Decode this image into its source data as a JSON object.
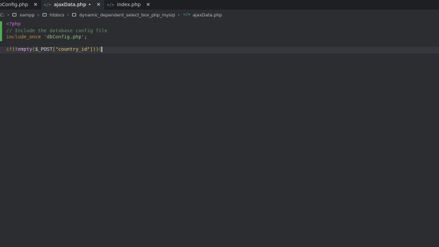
{
  "tabs": [
    {
      "label": "dbConfig.php",
      "icon": "",
      "active": false,
      "dirty": false,
      "close": "✕"
    },
    {
      "label": "ajaxData.php",
      "icon": "</>",
      "active": true,
      "dirty": true,
      "close": "✕",
      "dirty_mark": "•"
    },
    {
      "label": "index.php",
      "icon": "</>",
      "active": false,
      "dirty": false,
      "close": "✕"
    }
  ],
  "breadcrumb": {
    "root": "C:",
    "items": [
      "xampp",
      "htdocs",
      "dynamic_dependent_select_box_php_mysql",
      "ajaxData.php"
    ],
    "file_icon": "</>"
  },
  "editor": {
    "lines": [
      {
        "parts": [
          [
            "<?php",
            "t-php"
          ]
        ]
      },
      {
        "parts": [
          [
            "// Include the database config file",
            "t-comment"
          ]
        ]
      },
      {
        "parts": [
          [
            "include_once ",
            "t-kw"
          ],
          [
            "'dbConfig.php'",
            "t-str"
          ],
          [
            ";",
            "t-plain"
          ]
        ]
      },
      {
        "parts": []
      },
      {
        "parts": [
          [
            "if",
            "t-kw"
          ],
          [
            "(",
            "t-paren"
          ],
          [
            "!",
            "t-plain"
          ],
          [
            "empty",
            "t-fn"
          ],
          [
            "(",
            "t-paren"
          ],
          [
            "$_POST",
            "t-var"
          ],
          [
            "[",
            "t-paren"
          ],
          [
            "\"country_id\"",
            "t-key"
          ],
          [
            "]",
            "t-paren"
          ],
          [
            ")",
            "t-paren"
          ],
          [
            ")",
            "t-paren"
          ],
          [
            "{",
            "t-brace"
          ]
        ]
      }
    ]
  },
  "colors": {
    "background": "#2b2d31",
    "tabbar": "#1e1f22",
    "modified_gutter": "#4caf50",
    "php_icon": "#519aba"
  }
}
